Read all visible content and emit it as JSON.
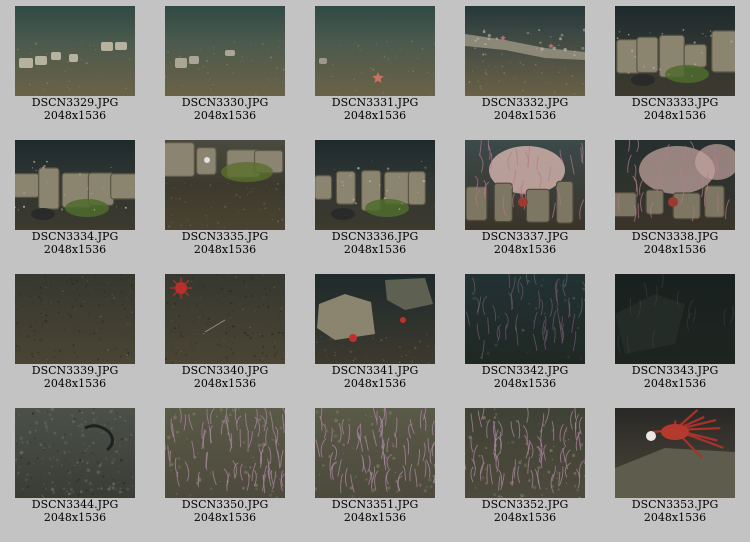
{
  "gallery": {
    "items": [
      {
        "filename": "DSCN3329.JPG",
        "dimensions": "2048x1536",
        "scene": "flat-rocks"
      },
      {
        "filename": "DSCN3330.JPG",
        "dimensions": "2048x1536",
        "scene": "flat-few"
      },
      {
        "filename": "DSCN3331.JPG",
        "dimensions": "2048x1536",
        "scene": "flat-star"
      },
      {
        "filename": "DSCN3332.JPG",
        "dimensions": "2048x1536",
        "scene": "wall-far"
      },
      {
        "filename": "DSCN3333.JPG",
        "dimensions": "2048x1536",
        "scene": "wall-green"
      },
      {
        "filename": "DSCN3334.JPG",
        "dimensions": "2048x1536",
        "scene": "wall-green"
      },
      {
        "filename": "DSCN3335.JPG",
        "dimensions": "2048x1536",
        "scene": "ledge-green"
      },
      {
        "filename": "DSCN3336.JPG",
        "dimensions": "2048x1536",
        "scene": "wall-green"
      },
      {
        "filename": "DSCN3337.JPG",
        "dimensions": "2048x1536",
        "scene": "sponge"
      },
      {
        "filename": "DSCN3338.JPG",
        "dimensions": "2048x1536",
        "scene": "sponge-dark"
      },
      {
        "filename": "DSCN3339.JPG",
        "dimensions": "2048x1536",
        "scene": "sediment"
      },
      {
        "filename": "DSCN3340.JPG",
        "dimensions": "2048x1536",
        "scene": "sediment-crab"
      },
      {
        "filename": "DSCN3341.JPG",
        "dimensions": "2048x1536",
        "scene": "rocks-crab"
      },
      {
        "filename": "DSCN3342.JPG",
        "dimensions": "2048x1536",
        "scene": "dark-coral"
      },
      {
        "filename": "DSCN3343.JPG",
        "dimensions": "2048x1536",
        "scene": "very-dark"
      },
      {
        "filename": "DSCN3344.JPG",
        "dimensions": "2048x1536",
        "scene": "rock-closeup"
      },
      {
        "filename": "DSCN3350.JPG",
        "dimensions": "2048x1536",
        "scene": "anemones"
      },
      {
        "filename": "DSCN3351.JPG",
        "dimensions": "2048x1536",
        "scene": "anemones"
      },
      {
        "filename": "DSCN3352.JPG",
        "dimensions": "2048x1536",
        "scene": "anemones-dark"
      },
      {
        "filename": "DSCN3353.JPG",
        "dimensions": "2048x1536",
        "scene": "crab-closeup"
      }
    ]
  },
  "colors": {
    "background": "#c3c3c3",
    "caption_text": "#000000"
  }
}
